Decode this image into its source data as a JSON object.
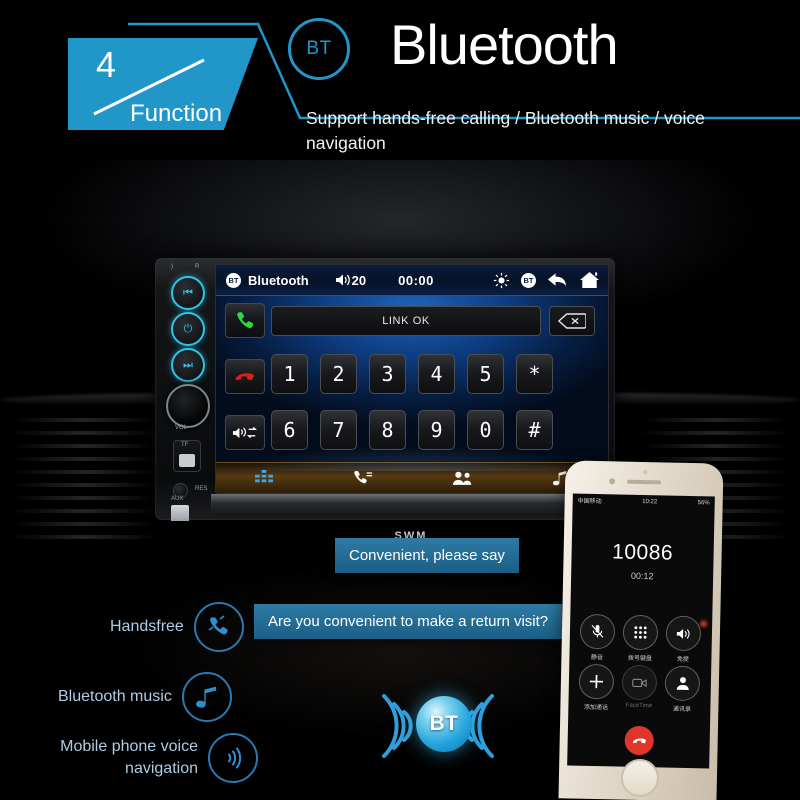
{
  "header": {
    "badge_number": "4",
    "badge_label": "Function",
    "bt_abbr": "BT",
    "title": "Bluetooth",
    "subtitle": "Support hands-free calling / Bluetooth music / voice navigation"
  },
  "head_unit": {
    "brand": "SWM",
    "left_panel": {
      "mic_label": "·)",
      "reset_label": "R",
      "prev_icon": "⏮",
      "power_icon": "⏻",
      "next_icon": "⏭",
      "volume_label": "VOL",
      "tf_label": "TF",
      "aux_label": "AUX",
      "res_label": "RES"
    },
    "statusbar": {
      "bt_abbr": "BT",
      "source": "Bluetooth",
      "volume": "20",
      "clock": "00:00",
      "brightness_icon": "brightness-icon",
      "bt_badge": "BT",
      "back_icon": "back-arrow-icon",
      "home_icon": "home-icon"
    },
    "dialer": {
      "number_field": "LINK OK",
      "delete_icon": "backspace-icon",
      "answer_icon": "green-handset-icon",
      "hangup_icon": "red-handset-icon",
      "audio_transfer_icon": "speaker-swap-icon",
      "keys": [
        "1",
        "2",
        "3",
        "4",
        "5",
        "*",
        "6",
        "7",
        "8",
        "9",
        "0",
        "#"
      ]
    },
    "navbar": [
      {
        "name": "keypad-tab",
        "icon": "keypad-icon",
        "active": true
      },
      {
        "name": "call-log-tab",
        "icon": "call-log-icon",
        "active": false
      },
      {
        "name": "contacts-tab",
        "icon": "contacts-icon",
        "active": false
      },
      {
        "name": "music-tab",
        "icon": "music-note-icon",
        "active": false
      }
    ]
  },
  "bubbles": {
    "reply": "Convenient, please say",
    "question": "Are you convenient to make a return visit?"
  },
  "features": [
    {
      "label": "Handsfree",
      "icon": "handset-icon"
    },
    {
      "label": "Bluetooth music",
      "icon": "music-note-icon"
    },
    {
      "label": "Mobile phone voice navigation",
      "icon": "sound-wave-icon"
    }
  ],
  "bt_logo": {
    "abbr": "BT",
    "waves": "sound-wave-arcs"
  },
  "phone": {
    "carrier": "中国移动",
    "time": "10:22",
    "battery": "56%",
    "number": "10086",
    "duration": "00:12",
    "buttons": [
      {
        "label": "静音",
        "icon": "mute-icon"
      },
      {
        "label": "拨号键盘",
        "icon": "keypad-icon"
      },
      {
        "label": "免提",
        "icon": "speaker-icon"
      },
      {
        "label": "添加通话",
        "icon": "add-call-icon"
      },
      {
        "label": "FaceTime",
        "icon": "facetime-icon"
      },
      {
        "label": "通讯录",
        "icon": "contacts-icon"
      }
    ],
    "end_call_icon": "end-call-icon"
  },
  "colors": {
    "accent": "#2196c9",
    "accent_light": "#2fc4e8",
    "bubble": "#1b5e85",
    "feature_text": "#aecde4"
  }
}
